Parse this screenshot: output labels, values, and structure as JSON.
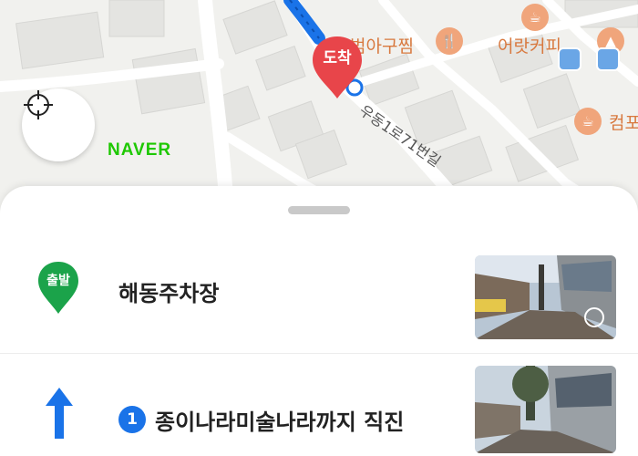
{
  "map": {
    "arrival_pin_label": "도착",
    "poi_labels": [
      {
        "text": "범아구찜",
        "icon": "restaurant-icon"
      },
      {
        "text": "어랏커피",
        "icon": "cafe-icon"
      },
      {
        "text": "컴포",
        "icon": "cafe-icon"
      }
    ],
    "street_label": "우동1로71번길",
    "provider_logo": "NAVER",
    "locate_button_icon": "crosshair-icon",
    "colors": {
      "route": "#1a73e8",
      "pin": "#e8454a",
      "poi": "#f0a57b",
      "logo": "#1ec800"
    }
  },
  "route": {
    "start": {
      "badge": "출발",
      "title": "해동주차장"
    },
    "steps": [
      {
        "number": "1",
        "title": "종이나라미술나라까지 직진",
        "icon": "arrow-up-icon"
      }
    ]
  }
}
